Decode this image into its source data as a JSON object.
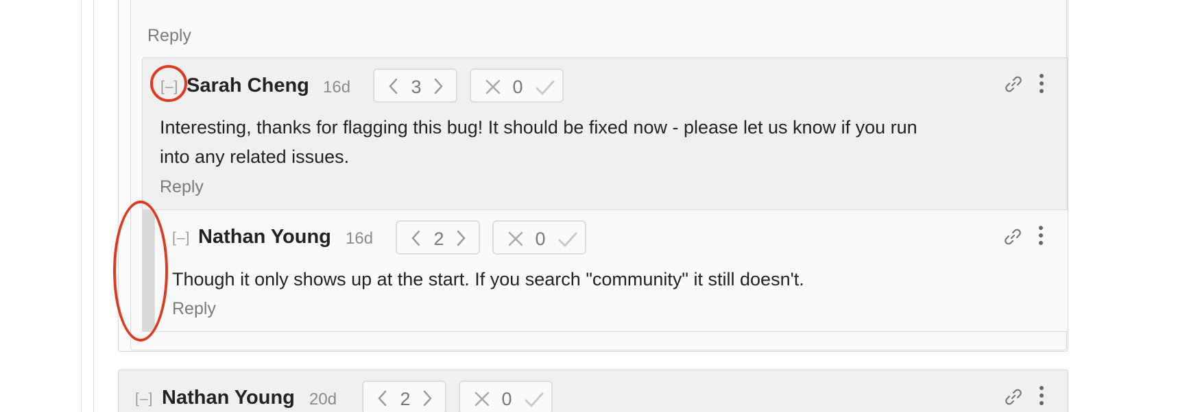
{
  "comments": [
    {
      "collapse_label": "[–]",
      "author": "Sarah Cheng",
      "age": "16d",
      "karma": "3",
      "agreement": "0",
      "body_lines": [
        "Interesting, thanks for flagging this bug! It should be fixed now - please let us know if you run",
        "into any related issues."
      ],
      "reply_label": "Reply"
    },
    {
      "collapse_label": "[–]",
      "author": "Nathan Young",
      "age": "16d",
      "karma": "2",
      "agreement": "0",
      "body_lines": [
        "Though it only shows up at the start. If you search \"community\" it still doesn't."
      ],
      "reply_label": "Reply"
    },
    {
      "collapse_label": "[–]",
      "author": "Nathan Young",
      "age": "20d",
      "karma": "2",
      "agreement": "0"
    }
  ],
  "prev_reply_label": "Reply",
  "icons": [
    "link-icon",
    "more-vertical-icon",
    "chevron-left-icon",
    "chevron-right-icon",
    "x-icon",
    "check-icon"
  ],
  "colors": {
    "annotation": "#dd3a1f",
    "thread_bar": "#d9d9d9",
    "nested_bg": "#f0f0f0"
  }
}
